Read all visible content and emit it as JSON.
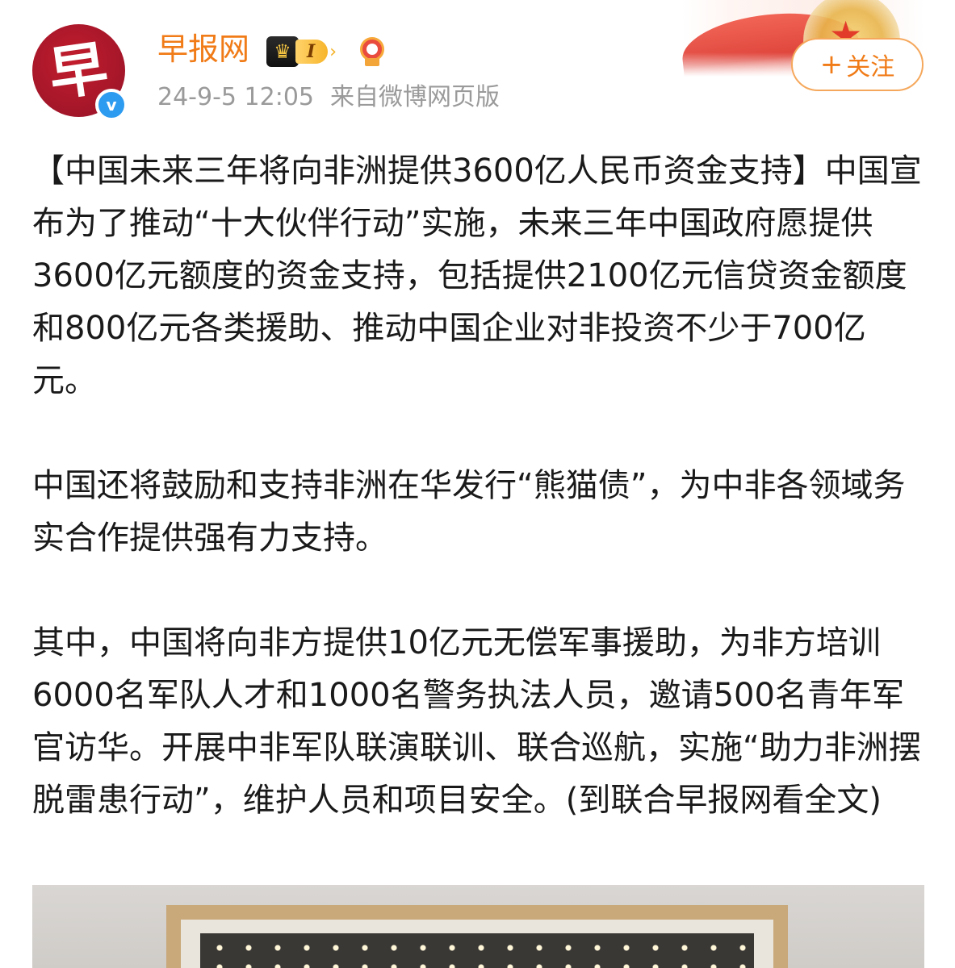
{
  "header": {
    "avatar_glyph": "早",
    "verified_mark": "v",
    "user_name": "早报网",
    "vip_level": "I",
    "vip_crown_icon": "crown-icon",
    "medal_icon": "medal-icon",
    "timestamp": "24-9-5 12:05",
    "source": "来自微博网页版",
    "follow_label": "关注",
    "follow_plus": "+"
  },
  "post": {
    "paragraphs": [
      "【中国未来三年将向非洲提供3600亿人民币资金支持】中国宣布为了推动“十大伙伴行动”实施，未来三年中国政府愿提供3600亿元额度的资金支持，包括提供2100亿元信贷资金额度和800亿元各类援助、推动中国企业对非投资不少于700亿元。",
      "中国还将鼓励和支持非洲在华发行“熊猫债”，为中非各领域务实合作提供强有力支持。",
      "其中，中国将向非方提供10亿元无偿军事援助，为非方培训6000名军队人才和1000名警务执法人员，邀请500名青年军官访华。开展中非军队联演联训、联合巡航，实施“助力非洲摆脱雷患行动”，维护人员和项目安全。(到联合早报网看全文)"
    ]
  },
  "colors": {
    "accent_orange": "#f07b17",
    "avatar_red": "#a3162a",
    "verified_blue": "#2d9bf0",
    "meta_gray": "#9a9a9a"
  }
}
